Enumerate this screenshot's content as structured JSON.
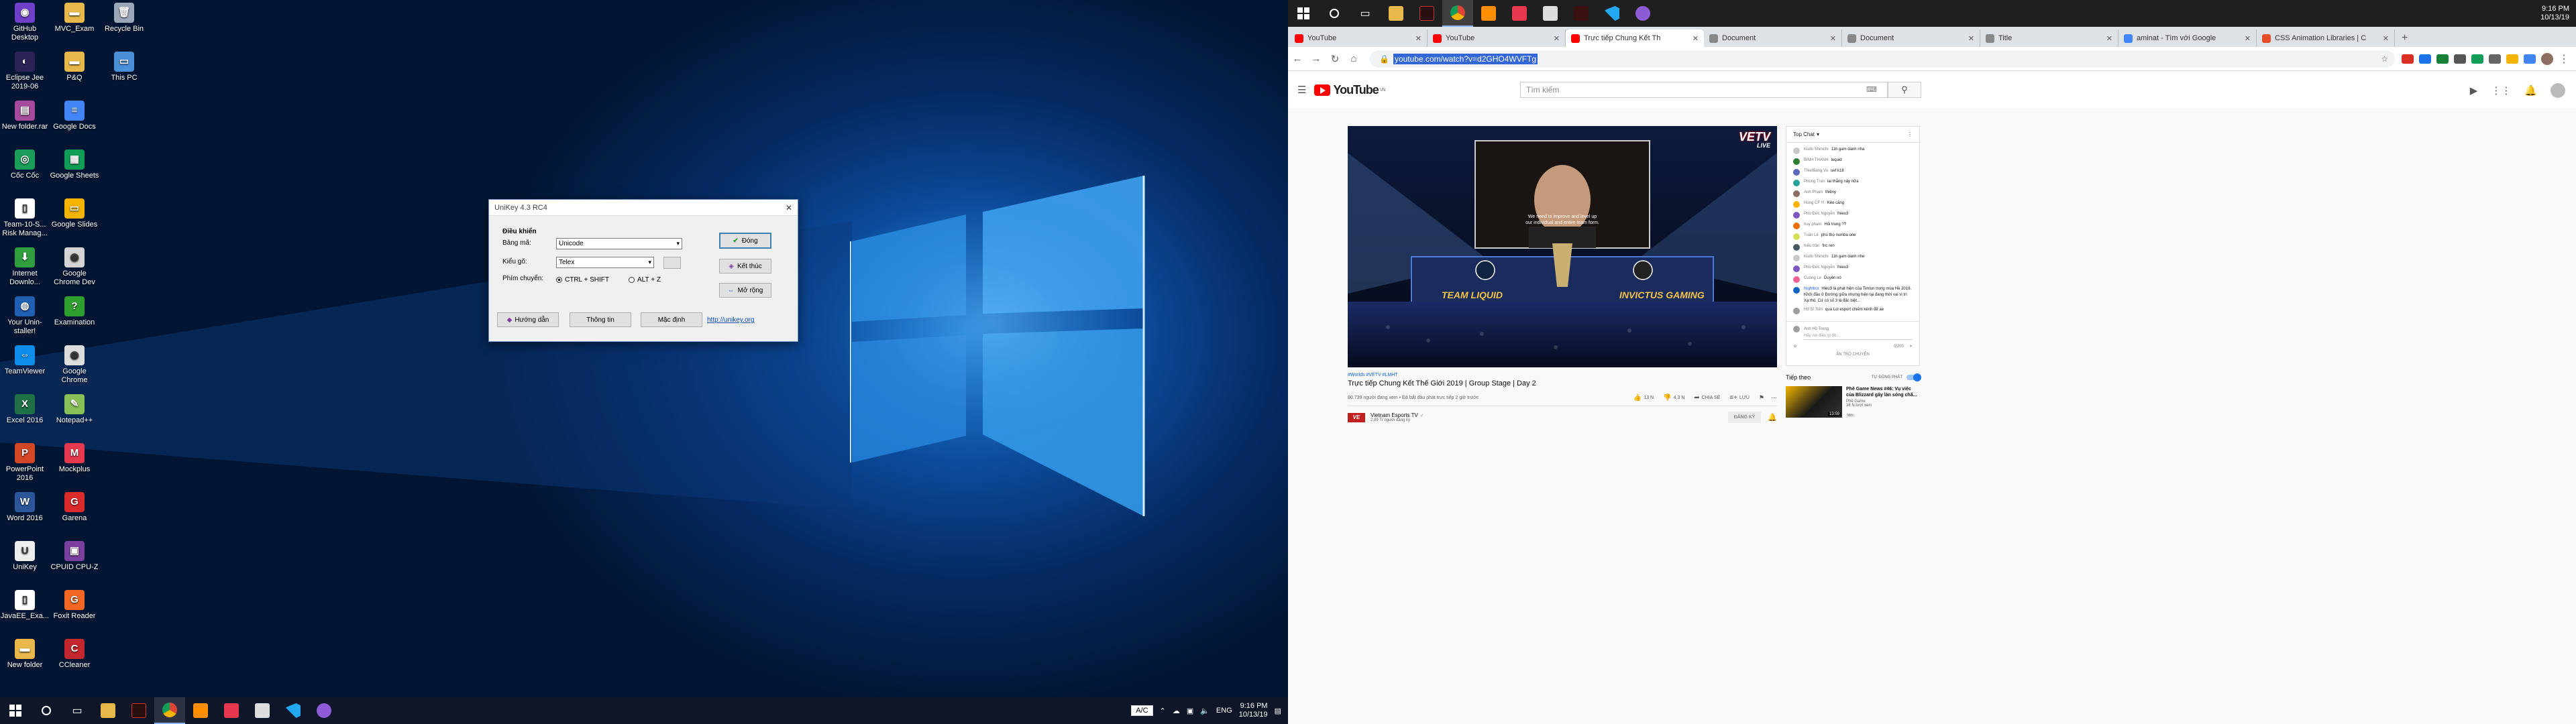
{
  "desktop": {
    "icons": [
      {
        "label": "GitHub Desktop",
        "color": "#6e40c9",
        "glyph": "◉"
      },
      {
        "label": "MVC_Exam",
        "color": "#e8b84a",
        "glyph": "▬"
      },
      {
        "label": "Recycle Bin",
        "color": "#9aa7b8",
        "glyph": "🗑"
      },
      {
        "label": "Eclipse Jee 2019-06",
        "color": "#2c2255",
        "glyph": "◐"
      },
      {
        "label": "P&Q",
        "color": "#e8b84a",
        "glyph": "▬"
      },
      {
        "label": "This PC",
        "color": "#4a90d9",
        "glyph": "▭"
      },
      {
        "label": "New folder.rar",
        "color": "#a64b9c",
        "glyph": "▤"
      },
      {
        "label": "Google Docs",
        "color": "#4285f4",
        "glyph": "≡"
      },
      {
        "label": "Cốc Cốc",
        "color": "#1a9e5a",
        "glyph": "◎"
      },
      {
        "label": "Google Sheets",
        "color": "#0f9d58",
        "glyph": "▦"
      },
      {
        "label": "Team-10-S... Risk Manag...",
        "color": "#ffffff",
        "glyph": "▯"
      },
      {
        "label": "Google Slides",
        "color": "#f4b400",
        "glyph": "▭"
      },
      {
        "label": "Internet Downlo...",
        "color": "#2e9e3f",
        "glyph": "⬇"
      },
      {
        "label": "Google Chrome Dev",
        "color": "#d4d4d4",
        "glyph": "◉"
      },
      {
        "label": "Your Unin-staller!",
        "color": "#1f5fb4",
        "glyph": "◍"
      },
      {
        "label": "Examination",
        "color": "#2f9f2f",
        "glyph": "?"
      },
      {
        "label": "TeamViewer",
        "color": "#0e8ee9",
        "glyph": "⇔"
      },
      {
        "label": "Google Chrome",
        "color": "#dddddd",
        "glyph": "◉"
      },
      {
        "label": "Excel 2016",
        "color": "#1e7145",
        "glyph": "X"
      },
      {
        "label": "Notepad++",
        "color": "#88c057",
        "glyph": "✎"
      },
      {
        "label": "PowerPoint 2016",
        "color": "#d24726",
        "glyph": "P"
      },
      {
        "label": "Mockplus",
        "color": "#e63950",
        "glyph": "M"
      },
      {
        "label": "Word 2016",
        "color": "#2b579a",
        "glyph": "W"
      },
      {
        "label": "Garena",
        "color": "#d92b2b",
        "glyph": "G"
      },
      {
        "label": "UniKey",
        "color": "#eeeeee",
        "glyph": "U"
      },
      {
        "label": "CPUID CPU-Z",
        "color": "#7b3fa0",
        "glyph": "▣"
      },
      {
        "label": "JavaEE_Exa...",
        "color": "#ffffff",
        "glyph": "▯"
      },
      {
        "label": "Foxit Reader",
        "color": "#f26722",
        "glyph": "G"
      },
      {
        "label": "New folder",
        "color": "#e8b84a",
        "glyph": "▬"
      },
      {
        "label": "CCleaner",
        "color": "#c4262e",
        "glyph": "C"
      }
    ],
    "unikey": {
      "title": "UniKey 4.3 RC4",
      "group_label": "Điều khiển",
      "charset_label": "Bảng mã:",
      "charset_value": "Unicode",
      "method_label": "Kiểu gõ:",
      "method_value": "Telex",
      "hotkey_label": "Phím chuyển:",
      "hotkey_opt1": "CTRL + SHIFT",
      "hotkey_opt2": "ALT + Z",
      "close_btn": "Đóng",
      "exit_btn": "Kết thúc",
      "expand_btn": "Mở rộng",
      "guide_btn": "Hướng dẫn",
      "info_btn": "Thông tin",
      "default_btn": "Mặc định",
      "link": "http://unikey.org"
    },
    "taskbar": {
      "lang": "ENG",
      "time": "9:16 PM",
      "date": "10/13/19",
      "input_mode": "A/C"
    }
  },
  "right_taskbar": {
    "time": "9:16 PM",
    "date": "10/13/19"
  },
  "browser": {
    "tabs": [
      {
        "title": "YouTube",
        "color": "#ff0000",
        "active": false
      },
      {
        "title": "YouTube",
        "color": "#ff0000",
        "active": false
      },
      {
        "title": "Trực tiếp Chung Kết Th",
        "color": "#ff0000",
        "active": true
      },
      {
        "title": "Document",
        "color": "#888888",
        "active": false
      },
      {
        "title": "Document",
        "color": "#888888",
        "active": false
      },
      {
        "title": "Title",
        "color": "#888888",
        "active": false
      },
      {
        "title": "aminat - Tìm với Google",
        "color": "#4285f4",
        "active": false
      },
      {
        "title": "CSS Animation Libraries | C",
        "color": "#e44d26",
        "active": false
      }
    ],
    "url": "youtube.com/watch?v=d2GHO4WVFTg"
  },
  "youtube": {
    "logo": "YouTube",
    "logo_country": "VN",
    "search_placeholder": "Tìm kiếm",
    "video": {
      "hashtags": "#Worlds #VETV #LMHT",
      "title": "Trực tiếp Chung Kết Thế Giới 2019 | Group Stage | Day 2",
      "views": "80.739 người đang xem • Đã bắt đầu phát trực tiếp 2 giờ trước",
      "likes": "13 N",
      "dislikes": "4,3 N",
      "share": "CHIA SẺ",
      "save": "LƯU",
      "overlay_brand": "VETV",
      "overlay_live": "LIVE",
      "subtitle_line1": "We need to improve and level up",
      "subtitle_line2": "our individual and entire team form.",
      "banner_left": "TEAM LIQUID",
      "banner_right": "INVICTUS GAMING"
    },
    "channel": {
      "name": "Vietnam Esports TV",
      "subs": "2,89 Tr người đăng ký",
      "subscribe": "ĐĂNG KÝ"
    },
    "chat": {
      "header": "Top Chat",
      "messages": [
        {
          "name": "Kudo Shinichi",
          "text": "11h gam danh nha",
          "color": "#c8c8c8"
        },
        {
          "name": "BINH THANH",
          "text": "luquid",
          "color": "#2e7d32"
        },
        {
          "name": "ThietBang Vo",
          "text": "uef k18",
          "color": "#5c6bc0"
        },
        {
          "name": "Phong Tran",
          "text": "lai thắng này nữa",
          "color": "#26a69a"
        },
        {
          "name": "Anh Phạm",
          "text": "thiệny",
          "color": "#8d6e63"
        },
        {
          "name": "Hùng CF !!!",
          "text": "Kéo căng",
          "color": "#ffb300"
        },
        {
          "name": "Phú Đức Nguyễn",
          "text": "fnieu3",
          "color": "#7e57c2"
        },
        {
          "name": "huy pham",
          "text": "Hỏi trung ??",
          "color": "#ef6c00"
        },
        {
          "name": "Tuấn Lê",
          "text": "phú thọ numba one",
          "color": "#d4e157"
        },
        {
          "name": "hiếu trần",
          "text": "fnc ren",
          "color": "#455a64"
        },
        {
          "name": "Kudo Shinichi",
          "text": "11h gam danh nhe",
          "color": "#c8c8c8"
        },
        {
          "name": "Phú Đức Nguyễn",
          "text": "fnieu3",
          "color": "#7e57c2"
        },
        {
          "name": "Cuong Le",
          "text": "Duyên nó",
          "color": "#f06292"
        },
        {
          "name": "Nightbot",
          "text": "Hieu3 là phát hiện của Timlun trong mùa Hè 2019. Khởi đầu ở Đường giữa nhưng hiện tại đang thời vai vì trí Xạ thủ. Cứ có số 3 là đặc biệt...",
          "color": "#1565c0",
          "own": true
        },
        {
          "name": "Hồ Sĩ Tiến",
          "text": "qua Lol esport chiếm kênh để ae",
          "color": "#9e9e9e"
        }
      ],
      "input_user": "Anh Hồ Trung",
      "input_placeholder": "Hãy nói điều gì đó...",
      "counter": "0/200",
      "hide": "ẨN TRÒ CHUYỆN"
    },
    "upnext": {
      "label": "Tiếp theo",
      "autoplay": "TỰ ĐỘNG PHÁT",
      "title": "Phê Game News #46: Vụ việc của Blizzard gây làn sóng chấ...",
      "channel": "Phê Game",
      "views": "38 N lượt xem",
      "badge": "Mới",
      "duration": "13:59"
    }
  }
}
